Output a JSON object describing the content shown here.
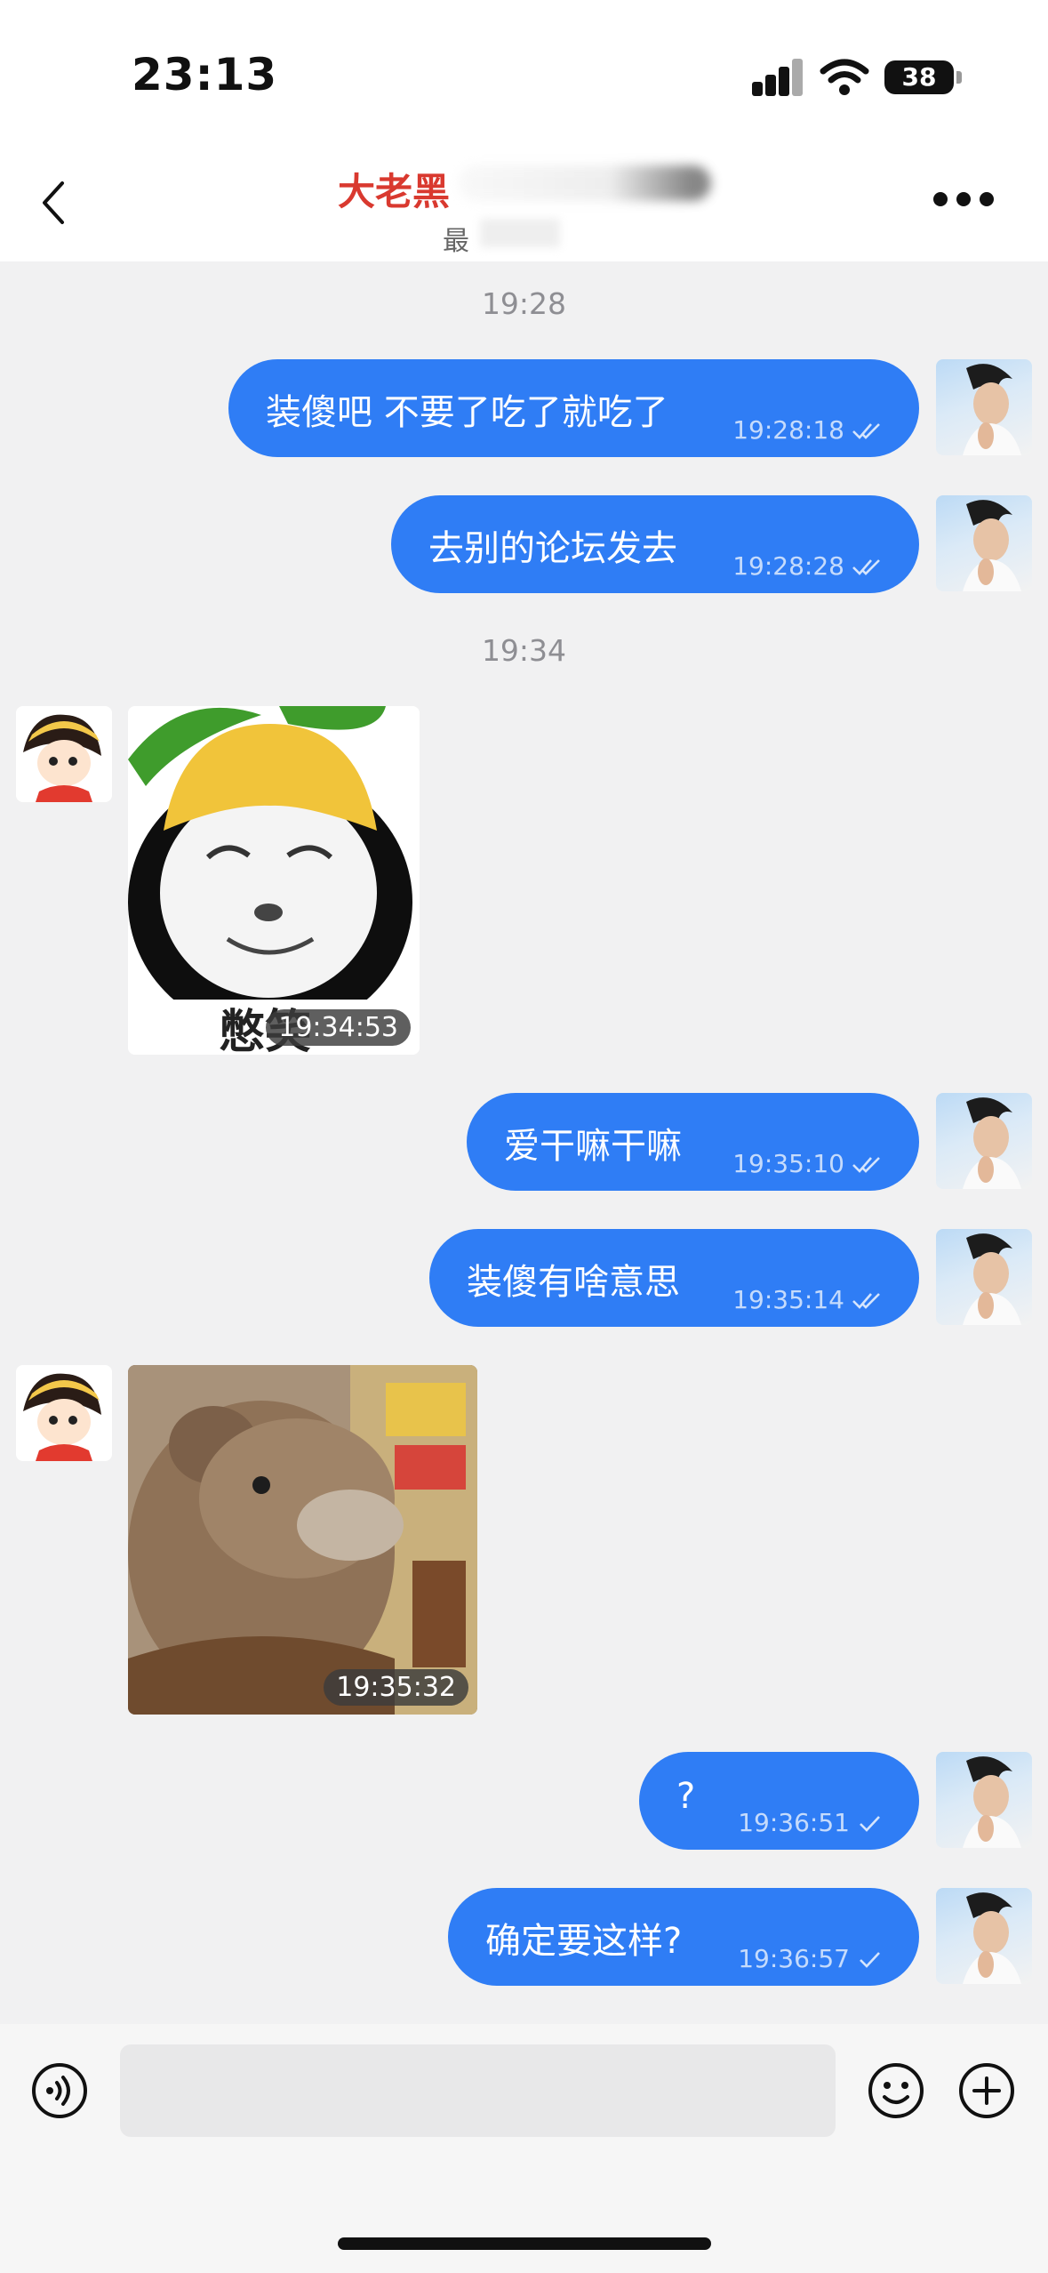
{
  "status_bar": {
    "time": "23:13",
    "battery": "38"
  },
  "header": {
    "contact_name": "大老黑",
    "status_text": "最"
  },
  "messages": {
    "divider_1": "19:28",
    "m1": {
      "text": "装傻吧 不要了吃了就吃了",
      "time": "19:28:18",
      "read": "double-check"
    },
    "m2": {
      "text": "去别的论坛发去",
      "time": "19:28:28",
      "read": "double-check"
    },
    "divider_2": "19:34",
    "m3": {
      "image": "lemon-panda-meme",
      "caption": "憋笑",
      "time": "19:34:53"
    },
    "m4": {
      "text": "爱干嘛干嘛",
      "time": "19:35:10",
      "read": "double-check"
    },
    "m5": {
      "text": "装傻有啥意思",
      "time": "19:35:14",
      "read": "double-check"
    },
    "m6": {
      "image": "teddy-bear-gif",
      "time": "19:35:32"
    },
    "m7": {
      "text": "?",
      "time": "19:36:51",
      "read": "single-check"
    },
    "m8": {
      "text": "确定要这样?",
      "time": "19:36:57",
      "read": "single-check"
    }
  },
  "input_bar": {
    "voice": "voice-icon",
    "emoji": "emoji-icon",
    "plus": "plus-icon"
  },
  "colors": {
    "bubble": "#2f7df5",
    "name": "#d9392f",
    "background": "#f1f1f2"
  }
}
